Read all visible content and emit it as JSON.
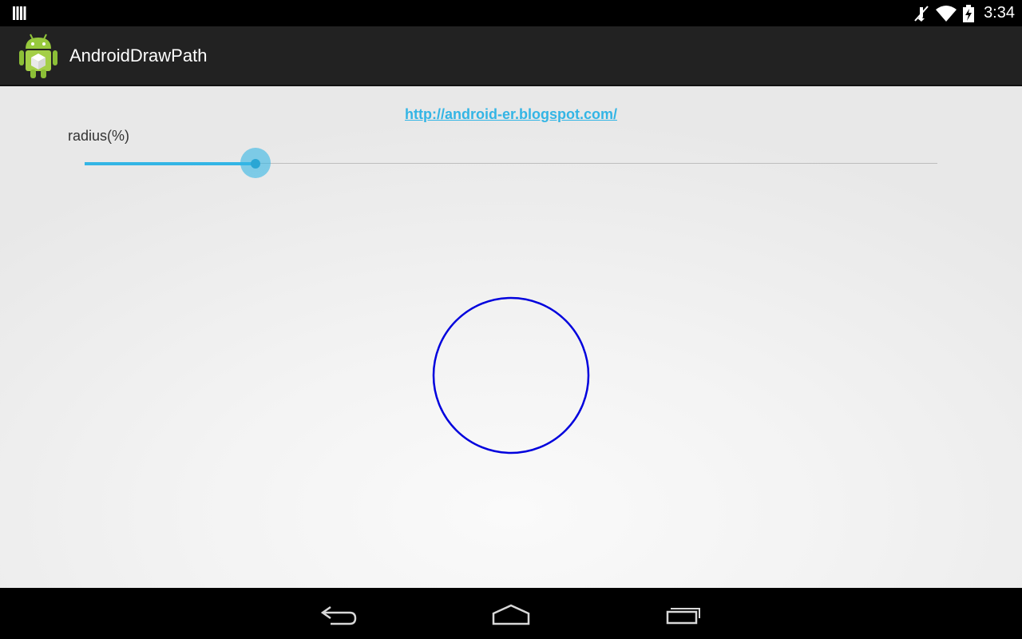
{
  "status_bar": {
    "time": "3:34",
    "icons": [
      "notification-bars-icon",
      "mute-icon",
      "wifi-icon",
      "battery-charging-icon"
    ]
  },
  "action_bar": {
    "app_title": "AndroidDrawPath",
    "app_icon": "android-robot-icon"
  },
  "content": {
    "link_text": "http://android-er.blogspot.com/",
    "radius_label": "radius(%)",
    "slider_value_fraction": 0.2,
    "circle_color": "#0000dd"
  },
  "nav_bar": {
    "icons": [
      "back-icon",
      "home-icon",
      "recent-apps-icon"
    ]
  },
  "colors": {
    "accent": "#33b5e5",
    "action_bar": "#222222"
  }
}
